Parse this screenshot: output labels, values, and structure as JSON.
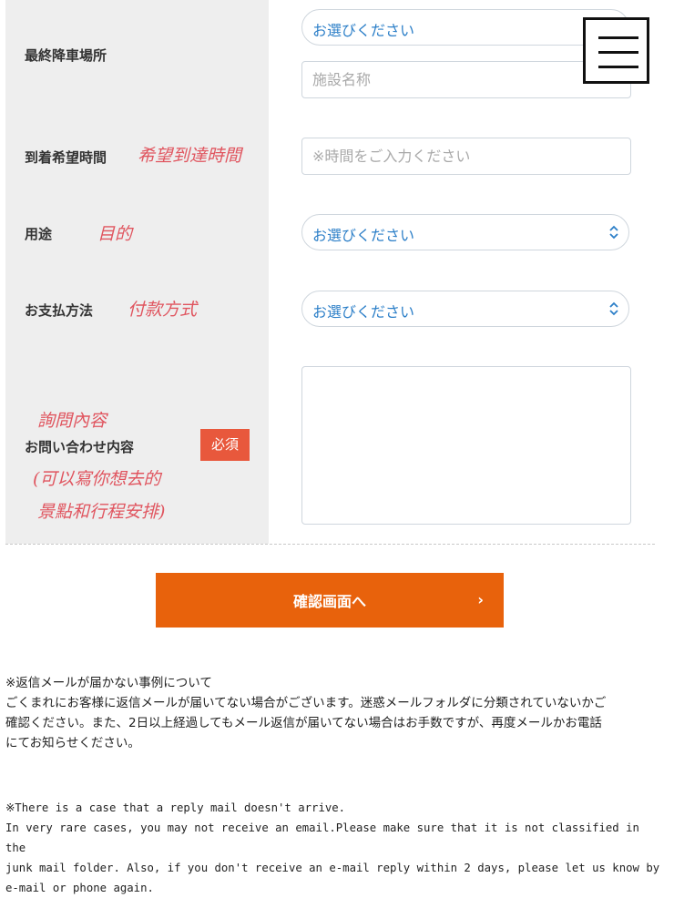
{
  "menu": {
    "icon": "hamburger-menu-icon"
  },
  "rows": {
    "drop": {
      "label": "最終降車場所",
      "select_value": "お選びください",
      "facility_placeholder": "施設名称"
    },
    "arrival": {
      "label": "到着希望時間",
      "note": "希望到達時間",
      "placeholder": "※時間をご入力ください"
    },
    "purpose": {
      "label": "用途",
      "note": "目的",
      "select_value": "お選びください"
    },
    "payment": {
      "label": "お支払方法",
      "note": "付款方式",
      "select_value": "お選びください"
    },
    "inquiry": {
      "label": "お問い合わせ内容",
      "required": "必須",
      "note_top": "詢問內容",
      "note_line1": "(可以寫你想去的",
      "note_line2": "景點和行程安排)",
      "value": ""
    }
  },
  "submit": {
    "label": "確認画面へ",
    "arrow": "›"
  },
  "notice_ja": {
    "line1": "※返信メールが届かない事例について",
    "line2": "ごくまれにお客様に返信メールが届いてない場合がございます。迷惑メールフォルダに分類されていないかご",
    "line3": "確認ください。また、2日以上経過してもメール返信が届いてない場合はお手数ですが、再度メールかお電話",
    "line4": "にてお知らせください。"
  },
  "notice_en": {
    "line1": "※There is a case that a reply mail doesn't arrive.",
    "line2": "In very rare cases, you may not receive an email.Please make sure that it is not classified in the",
    "line3": "junk mail folder. Also, if you don't receive an e-mail reply within 2 days, please let us know by",
    "line4": "e-mail or phone again."
  },
  "colors": {
    "accent": "#e8620c",
    "badge": "#e8583c",
    "select_text": "#2c7fc8",
    "handwriting": "#e0555f"
  }
}
